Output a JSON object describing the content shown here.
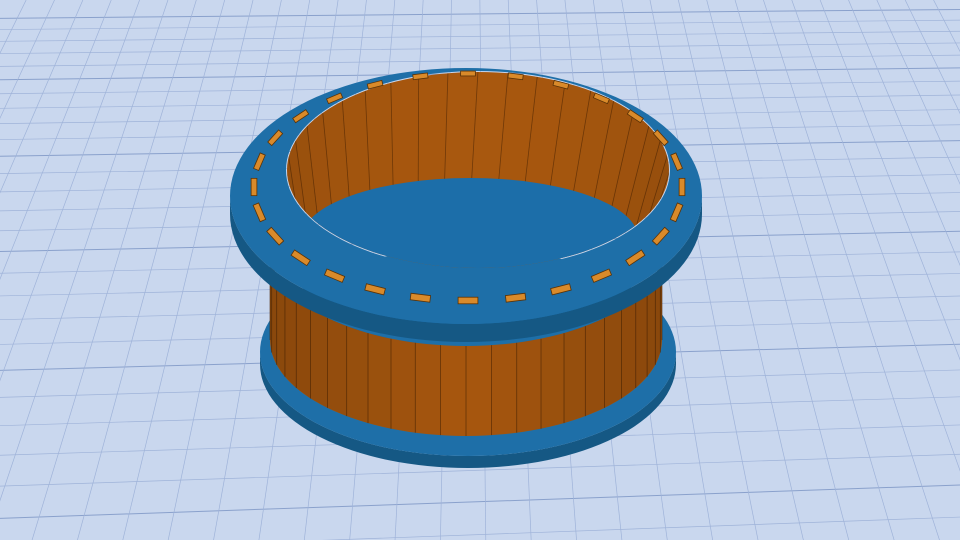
{
  "scene": {
    "background_color": "#c9d7ee",
    "grid_line_color": "#9fb3d9",
    "grid_major_color": "#8aa1cc",
    "object": {
      "type": "cylindrical-drum",
      "body_color": "#a8580f",
      "body_dark_color": "#8a4608",
      "body_light_color": "#c0701e",
      "flange_color": "#1e6fa8",
      "flange_dark_color": "#155884",
      "floor_color": "#1c6ea9",
      "slot_color": "#d98a2a",
      "stave_count": 24,
      "slot_count": 28
    }
  }
}
